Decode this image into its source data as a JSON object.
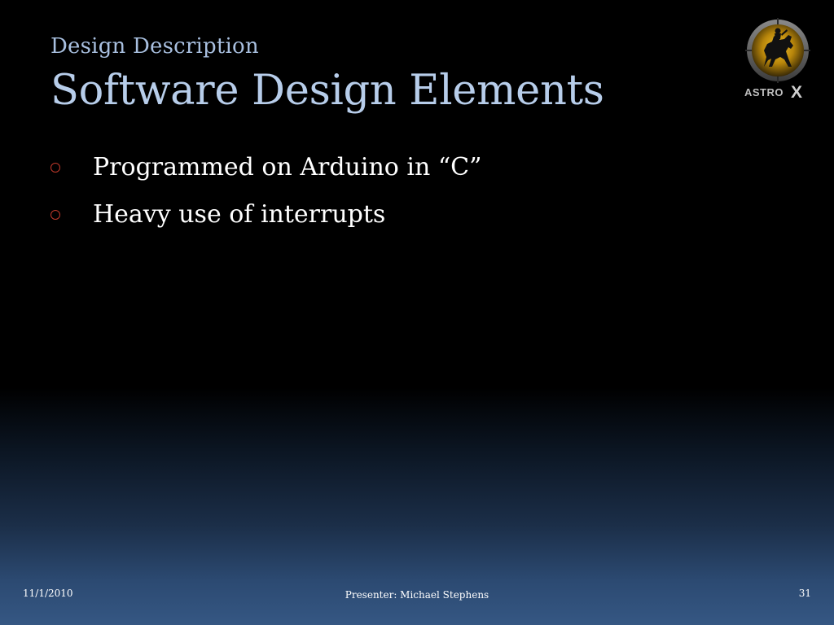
{
  "slide": {
    "subtitle": "Design Description",
    "title": "Software Design Elements",
    "bullets": [
      {
        "text": "Programmed on Arduino in “C”"
      },
      {
        "text": "Heavy use of interrupts"
      }
    ],
    "logo": {
      "icon": "astrox-horse-rider-logo",
      "text": "AstroX"
    },
    "footer": {
      "date": "11/1/2010",
      "presenter": "Presenter: Michael Stephens",
      "page_number": "31"
    },
    "colors": {
      "title": "#b7cdea",
      "subtitle": "#a8bfdf",
      "bullet_text": "#ffffff",
      "bullet_marker": "#c0392b",
      "background_top": "#000000",
      "background_bottom": "#355783",
      "logo_gold": "#d9a514"
    }
  }
}
